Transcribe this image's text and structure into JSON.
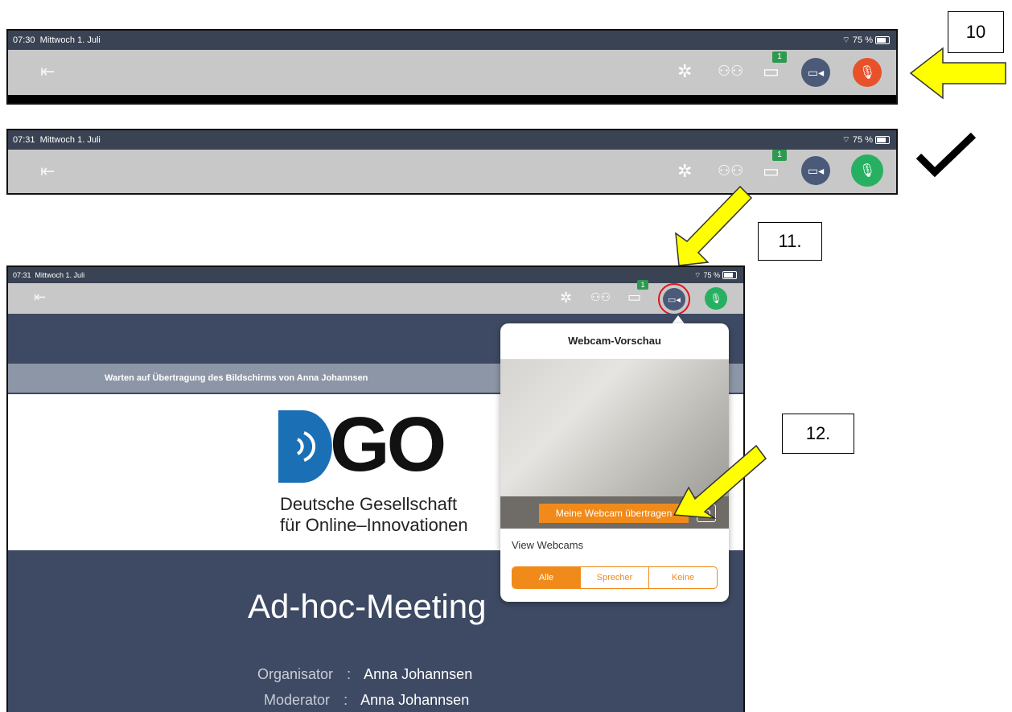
{
  "strip_top": {
    "time": "07:30",
    "date": "Mittwoch 1. Juli",
    "battery": "75 %",
    "chat_badge": "1",
    "mic_state": "muted",
    "mic_color": "#e8522b"
  },
  "strip_middle": {
    "time": "07:31",
    "date": "Mittwoch 1. Juli",
    "battery": "75 %",
    "chat_badge": "1",
    "mic_state": "active",
    "mic_color": "#27b062"
  },
  "annotations": {
    "step_10": "10",
    "step_11": "11.",
    "step_12": "12.",
    "checkmark": "✔"
  },
  "app": {
    "time": "07:31",
    "date": "Mittwoch 1. Juli",
    "battery": "75 %",
    "chat_badge": "1",
    "banner": "Warten auf Übertragung des Bildschirms von Anna Johannsen",
    "logo_text": "DGO",
    "logo_line1": "Deutsche Gesellschaft",
    "logo_line2": "für Online–Innovationen",
    "meeting_title": "Ad-hoc-Meeting",
    "organisator_label": "Organisator",
    "organisator_value": "Anna Johannsen",
    "moderator_label": "Moderator",
    "moderator_value": "Anna Johannsen",
    "separator": ":",
    "popover": {
      "title": "Webcam-Vorschau",
      "share_button": "Meine Webcam übertragen",
      "view_label": "View Webcams",
      "options": [
        "Alle",
        "Sprecher",
        "Keine"
      ],
      "selected": "Alle"
    }
  },
  "colors": {
    "accent": "#f08a1a",
    "arrow": "#ffff00",
    "highlight_ring": "#e0141e",
    "app_background": "#3e4a63"
  }
}
